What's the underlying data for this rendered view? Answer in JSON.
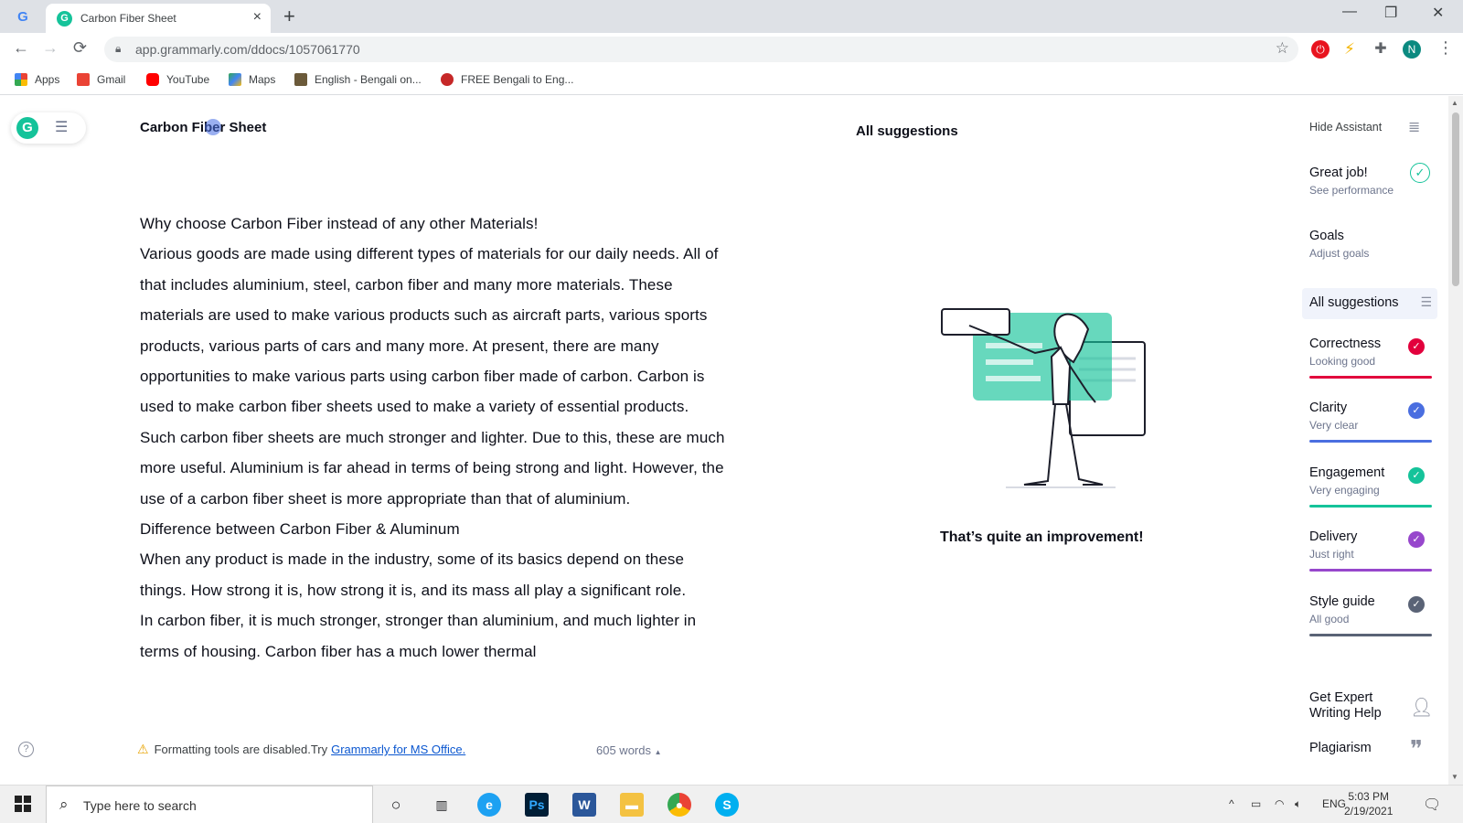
{
  "browser": {
    "tab_title": "Carbon Fiber Sheet",
    "url": "app.grammarly.com/ddocs/1057061770",
    "profile_initial": "N",
    "bookmarks": [
      {
        "label": "Apps"
      },
      {
        "label": "Gmail"
      },
      {
        "label": "YouTube"
      },
      {
        "label": "Maps"
      },
      {
        "label": "English - Bengali on..."
      },
      {
        "label": "FREE Bengali to Eng..."
      }
    ]
  },
  "editor": {
    "doc_title": "Carbon Fiber Sheet",
    "paragraphs": [
      "Why choose Carbon Fiber instead of any other Materials!",
      "Various goods are made using different types of materials for our daily needs. All of that includes aluminium, steel, carbon fiber and many more materials. These materials are used to make various products such as aircraft parts, various sports products, various parts of cars and many more. At present, there are many opportunities to make various parts using carbon fiber made of carbon. Carbon is used to make carbon fiber sheets used to make a variety of essential products. Such carbon fiber sheets are much stronger and lighter. Due to this, these are much more useful. Aluminium is far ahead in terms of being strong and light. However, the use of a carbon fiber sheet is more appropriate than that of aluminium.",
      "Difference between Carbon Fiber & Aluminum",
      "When any product is made in the industry, some of its basics depend on these things. How strong it is, how strong it is, and its mass all play a significant role.",
      "In carbon fiber, it is much stronger, stronger than aluminium, and much lighter in terms of housing. Carbon fiber has a much lower thermal"
    ],
    "footer_warning": "Formatting tools are disabled.Try",
    "footer_link": "Grammarly for MS Office.",
    "word_count": "605 words"
  },
  "suggestions_panel": {
    "header": "All suggestions",
    "message": "That’s quite an improvement!"
  },
  "sidebar": {
    "hide_assistant": "Hide Assistant",
    "great_job": "Great job!",
    "see_performance": "See performance",
    "goals": "Goals",
    "adjust_goals": "Adjust goals",
    "all_suggestions": "All suggestions",
    "categories": [
      {
        "name": "Correctness",
        "status": "Looking good",
        "color": "#e2003c"
      },
      {
        "name": "Clarity",
        "status": "Very clear",
        "color": "#4a6ee0"
      },
      {
        "name": "Engagement",
        "status": "Very engaging",
        "color": "#15c39a"
      },
      {
        "name": "Delivery",
        "status": "Just right",
        "color": "#9747cc"
      },
      {
        "name": "Style guide",
        "status": "All good",
        "color": "#5a6376"
      }
    ],
    "expert_help": "Get Expert Writing Help",
    "plagiarism": "Plagiarism"
  },
  "taskbar": {
    "search_placeholder": "Type here to search",
    "language": "ENG",
    "time": "5:03 PM",
    "date": "2/19/2021"
  }
}
